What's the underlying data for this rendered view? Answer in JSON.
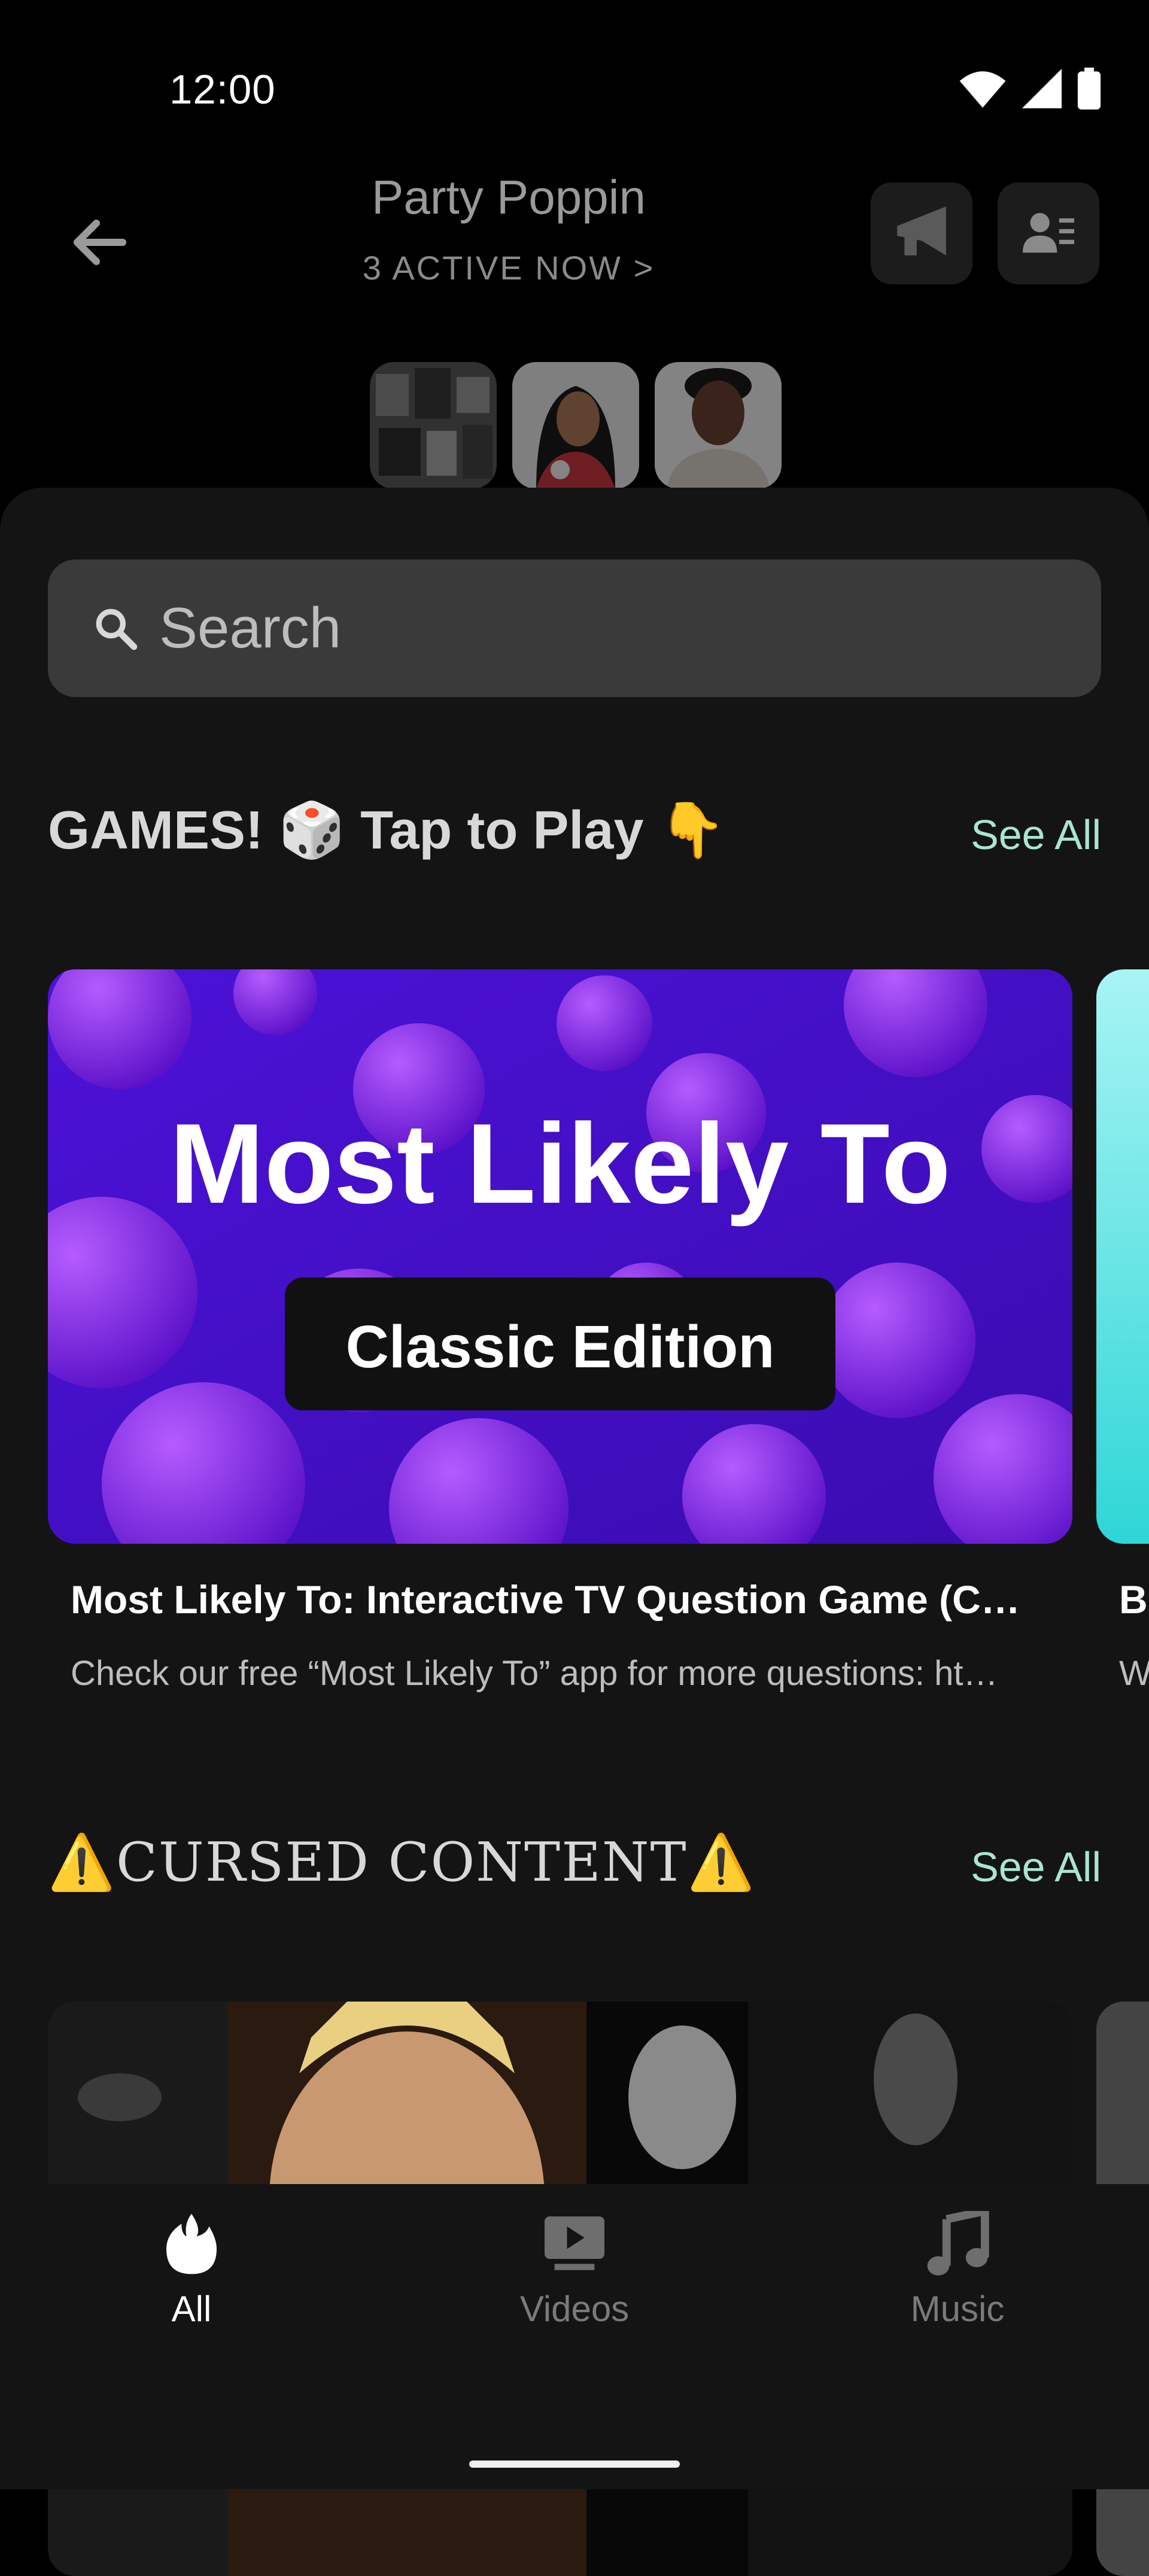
{
  "status_bar": {
    "time": "12:00"
  },
  "header": {
    "title": "Party Poppin",
    "active_now": "3 ACTIVE NOW >"
  },
  "search": {
    "placeholder": "Search"
  },
  "sections": [
    {
      "title": "GAMES! 🎲 Tap to Play 👇",
      "see_all": "See All",
      "cards": [
        {
          "thumb_title": "Most Likely To",
          "thumb_badge": "Classic Edition",
          "title": "Most Likely To: Interactive TV Question Game (C…",
          "description": "Check our free “Most Likely To” app for more questions: ht…"
        }
      ],
      "peek": {
        "title": "B",
        "description": "W"
      }
    },
    {
      "title": "⚠️CURSED CONTENT⚠️",
      "see_all": "See All"
    }
  ],
  "bottom_nav": [
    {
      "label": "All",
      "icon": "flame-icon",
      "active": true
    },
    {
      "label": "Videos",
      "icon": "play-box-icon",
      "active": false
    },
    {
      "label": "Music",
      "icon": "music-note-icon",
      "active": false
    }
  ],
  "colors": {
    "background": "#000000",
    "sheet": "#141414",
    "accent": "#a9e5cf",
    "search_bg": "#3a3a3a"
  }
}
